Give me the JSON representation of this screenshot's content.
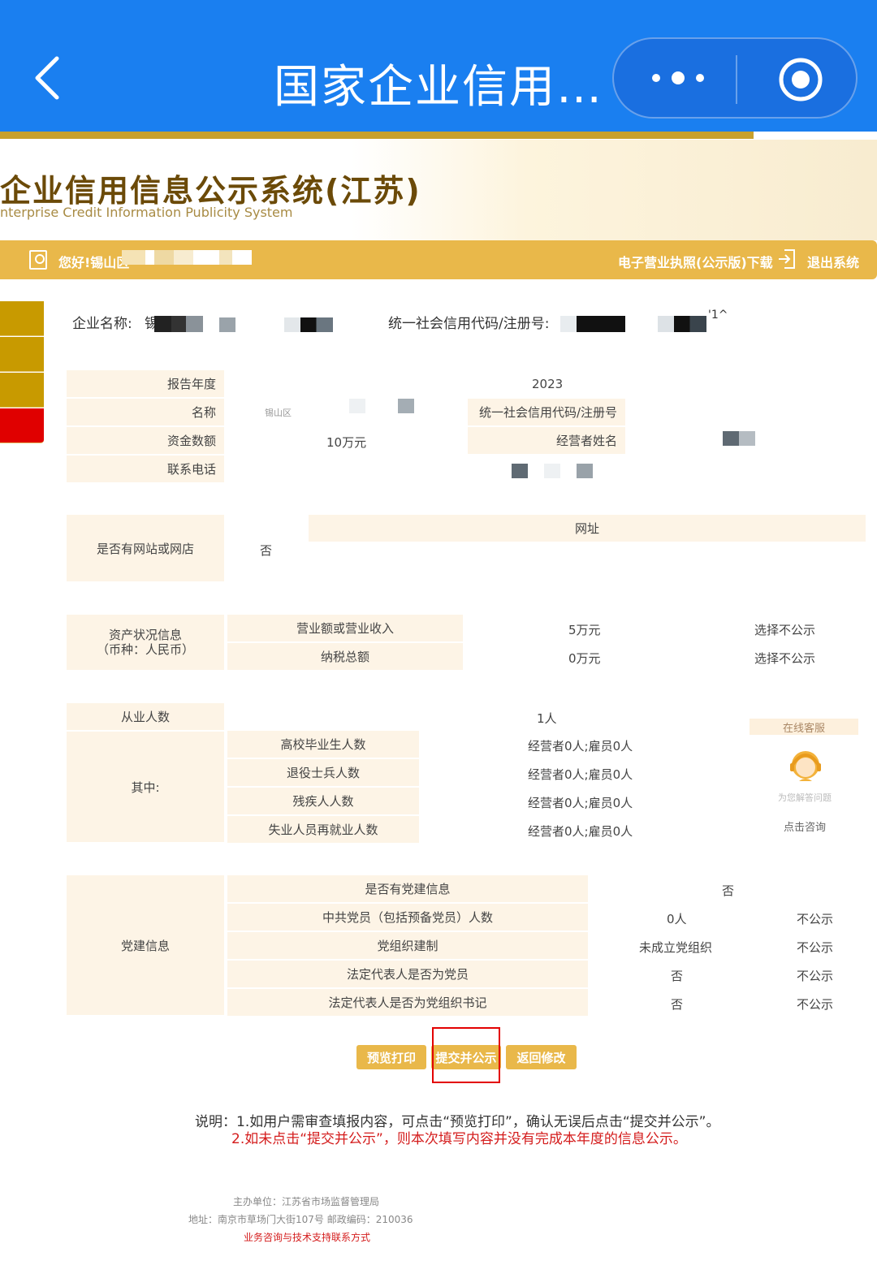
{
  "nav": {
    "title": "国家企业信用…",
    "back_icon": "chevron-left-icon",
    "more_icon": "more-dots-icon",
    "close_icon": "target-circle-icon"
  },
  "banner": {
    "title_cn": "企业信用信息公示系统(江苏)",
    "title_en": "nterprise Credit Information Publicity System"
  },
  "userbar": {
    "greeting": "您好!锡山区",
    "license_link": "电子营业执照(公示版)下载",
    "logout": "退出系统"
  },
  "enterprise": {
    "name_label": "企业名称:",
    "name_value": "锡",
    "code_label": "统一社会信用代码/注册号:",
    "code_tail": "'1^"
  },
  "basic": {
    "year_label": "报告年度",
    "year_value": "2023",
    "name_label": "名称",
    "name_value": "锡山区",
    "code_label": "统一社会信用代码/注册号",
    "capital_label": "资金数额",
    "capital_value": "10万元",
    "operator_label": "经营者姓名",
    "phone_label": "联系电话"
  },
  "website": {
    "label": "是否有网站或网店",
    "value": "否",
    "url_header": "网址"
  },
  "assets": {
    "label_line1": "资产状况信息",
    "label_line2": "（币种：人民币）",
    "rows": [
      {
        "label": "营业额或营业收入",
        "value": "5万元",
        "publicity": "选择不公示"
      },
      {
        "label": "纳税总额",
        "value": "0万元",
        "publicity": "选择不公示"
      }
    ]
  },
  "employees": {
    "label": "从业人数",
    "value": "1人",
    "sub_label": "其中:",
    "rows": [
      {
        "label": "高校毕业生人数",
        "value": "经营者0人;雇员0人"
      },
      {
        "label": "退役士兵人数",
        "value": "经营者0人;雇员0人"
      },
      {
        "label": "残疾人人数",
        "value": "经营者0人;雇员0人"
      },
      {
        "label": "失业人员再就业人数",
        "value": "经营者0人;雇员0人"
      }
    ]
  },
  "party": {
    "label": "党建信息",
    "rows": [
      {
        "label": "是否有党建信息",
        "value": "否",
        "publicity": ""
      },
      {
        "label": "中共党员（包括预备党员）人数",
        "value": "0人",
        "publicity": "不公示"
      },
      {
        "label": "党组织建制",
        "value": "未成立党组织",
        "publicity": "不公示"
      },
      {
        "label": "法定代表人是否为党员",
        "value": "否",
        "publicity": "不公示"
      },
      {
        "label": "法定代表人是否为党组织书记",
        "value": "否",
        "publicity": "不公示"
      }
    ]
  },
  "service": {
    "header": "在线客服",
    "subtitle": "为您解答问题",
    "link": "点击咨询",
    "avatar_icon": "customer-service-avatar-icon"
  },
  "buttons": {
    "preview": "预览打印",
    "submit": "提交并公示",
    "back": "返回修改"
  },
  "notes": {
    "line1": "说明：1.如用户需审查填报内容，可点击“预览打印”，确认无误后点击“提交并公示”。",
    "line2": "2.如未点击“提交并公示”，则本次填写内容并没有完成本年度的信息公示。"
  },
  "footer": {
    "host": "主办单位：江苏省市场监督管理局",
    "address": "地址：南京市草场门大街107号    邮政编码：210036",
    "support": "业务咨询与技术支持联系方式"
  },
  "colors": {
    "nav_blue": "#1a7ff0",
    "gold": "#e9b84a",
    "label_bg": "#fdf4e6",
    "accent_red": "#e30000"
  }
}
